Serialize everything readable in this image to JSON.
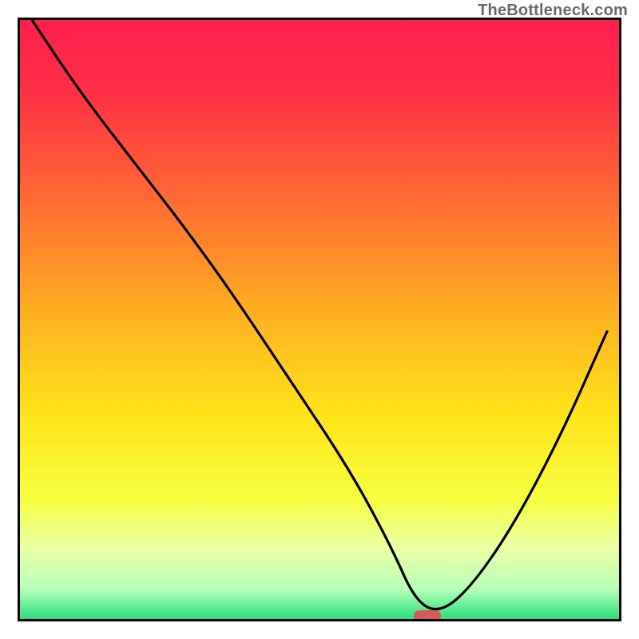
{
  "watermark": "TheBottleneck.com",
  "colors": {
    "border": "#000000",
    "curve": "#000000",
    "marker": "#d45a5d",
    "gradient_stops": [
      {
        "offset": 0.0,
        "color": "#ff1f4f"
      },
      {
        "offset": 0.12,
        "color": "#ff2f47"
      },
      {
        "offset": 0.3,
        "color": "#ff6b32"
      },
      {
        "offset": 0.5,
        "color": "#ffb321"
      },
      {
        "offset": 0.66,
        "color": "#ffe41a"
      },
      {
        "offset": 0.8,
        "color": "#f6ff3f"
      },
      {
        "offset": 0.88,
        "color": "#ecffa5"
      },
      {
        "offset": 0.95,
        "color": "#b7ffb9"
      },
      {
        "offset": 1.0,
        "color": "#28df7e"
      }
    ]
  },
  "chart_data": {
    "type": "line",
    "title": "",
    "xlabel": "",
    "ylabel": "",
    "xlim": [
      0,
      100
    ],
    "ylim": [
      0,
      100
    ],
    "grid": false,
    "legend": false,
    "curve_note": "V-shaped performance-mismatch curve; minimum around x≈68 indicates best match (green). Values are unlabeled, estimated from pixel positions on a 0–100 normalized scale.",
    "series": [
      {
        "name": "mismatch-curve",
        "x": [
          2,
          10,
          20,
          27,
          35,
          45,
          55,
          62,
          66,
          70,
          75,
          82,
          90,
          98
        ],
        "y": [
          100,
          88,
          75,
          66,
          55,
          40,
          25,
          12,
          3,
          1,
          5,
          15,
          30,
          48
        ]
      }
    ],
    "marker": {
      "name": "optimum",
      "x": 68,
      "y": 0.5,
      "color": "#d45a5d",
      "shape": "pill"
    },
    "background": {
      "type": "vertical-gradient",
      "meaning": "red (top) = high bottleneck %, green (bottom) = 0 % bottleneck"
    }
  }
}
